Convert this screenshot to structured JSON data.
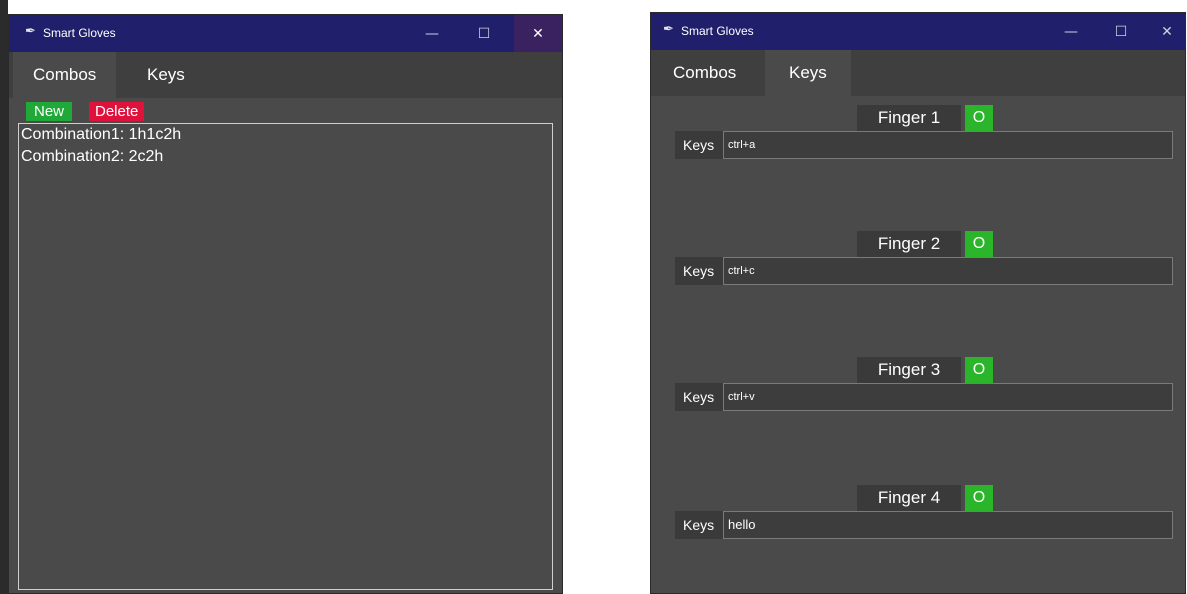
{
  "windows": [
    {
      "title": "Smart Gloves",
      "tabs": [
        {
          "label": "Combos",
          "active": true
        },
        {
          "label": "Keys",
          "active": false
        }
      ],
      "buttons": {
        "new": "New",
        "delete": "Delete"
      },
      "combos": [
        "Combination1: 1h1c2h",
        "Combination2: 2c2h"
      ]
    },
    {
      "title": "Smart Gloves",
      "tabs": [
        {
          "label": "Combos",
          "active": false
        },
        {
          "label": "Keys",
          "active": true
        }
      ],
      "keys_label": "Keys",
      "toggle_label": "O",
      "fingers": [
        {
          "name": "Finger 1",
          "keys": "ctrl+a"
        },
        {
          "name": "Finger 2",
          "keys": "ctrl+c"
        },
        {
          "name": "Finger 3",
          "keys": "ctrl+v"
        },
        {
          "name": "Finger 4",
          "keys": "hello"
        }
      ]
    }
  ],
  "colors": {
    "titlebar": "#1f1f6b",
    "toggle": "#2bb52b",
    "new": "#20a838",
    "delete": "#e0123c"
  }
}
